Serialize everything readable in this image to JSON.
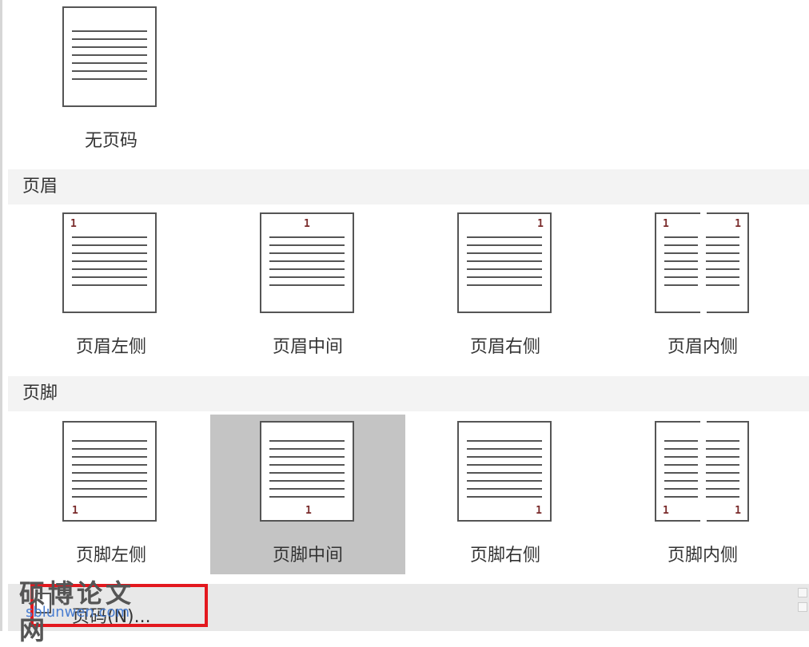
{
  "gallery": {
    "none": {
      "caption": "无页码"
    },
    "sections": [
      {
        "label": "页眉",
        "items": [
          {
            "caption": "页眉左侧",
            "page_number": "1"
          },
          {
            "caption": "页眉中间",
            "page_number": "1"
          },
          {
            "caption": "页眉右侧",
            "page_number": "1"
          },
          {
            "caption": "页眉内侧",
            "page_number": "1"
          }
        ]
      },
      {
        "label": "页脚",
        "items": [
          {
            "caption": "页脚左侧",
            "page_number": "1"
          },
          {
            "caption": "页脚中间",
            "page_number": "1",
            "selected": true
          },
          {
            "caption": "页脚右侧",
            "page_number": "1"
          },
          {
            "caption": "页脚内侧",
            "page_number": "1"
          }
        ]
      }
    ]
  },
  "bottom_action": {
    "label": "页码(N)..."
  },
  "watermark": {
    "title": "硕博论文网",
    "url": "sblunwen.com"
  },
  "colors": {
    "highlight": "#e3181e",
    "selected_bg": "#c4c4c4",
    "page_number": "#7a2b2b"
  }
}
